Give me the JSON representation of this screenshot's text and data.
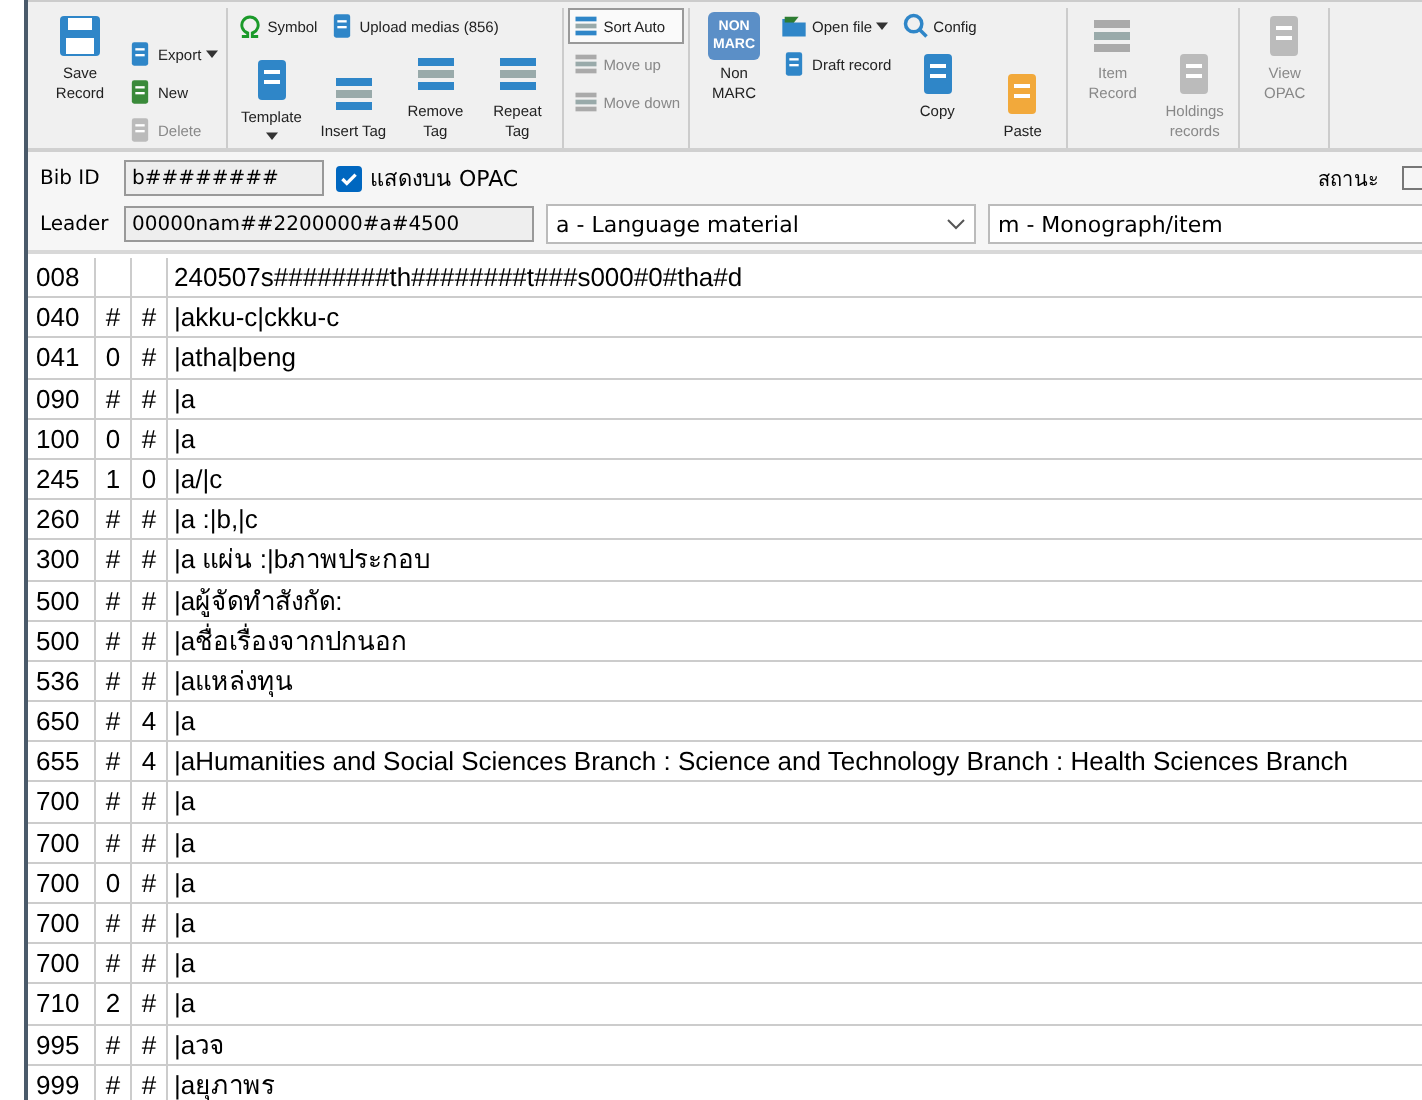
{
  "toolbar": {
    "groups": [
      {
        "columns": [
          [
            {
              "label": "Save Record",
              "kind": "large",
              "disabled": false
            }
          ],
          [
            {
              "label": "Export",
              "kind": "small",
              "disabled": false,
              "dropdown": true
            },
            {
              "label": "New",
              "kind": "small",
              "disabled": false
            },
            {
              "label": "Delete",
              "kind": "small",
              "disabled": true
            }
          ]
        ]
      },
      {
        "rows": [
          [
            {
              "label": "Symbol",
              "kind": "small",
              "disabled": false
            },
            {
              "label": "Upload medias (856)",
              "kind": "small",
              "disabled": false
            }
          ],
          [
            {
              "label": "Template",
              "kind": "large",
              "disabled": false,
              "dropdown": true
            },
            {
              "label": "Insert Tag",
              "kind": "large",
              "disabled": false
            },
            {
              "label": "Remove Tag",
              "kind": "large",
              "disabled": false
            },
            {
              "label": "Repeat Tag",
              "kind": "large",
              "disabled": false
            }
          ]
        ]
      },
      {
        "columns": [
          [
            {
              "label": "Sort Auto",
              "kind": "small",
              "disabled": false,
              "selected": true
            },
            {
              "label": "Move up",
              "kind": "small",
              "disabled": true
            },
            {
              "label": "Move down",
              "kind": "small",
              "disabled": true
            }
          ]
        ]
      },
      {
        "columns": [
          [
            {
              "label": "Non MARC",
              "kind": "large",
              "disabled": false,
              "badge": [
                "NON",
                "MARC"
              ]
            }
          ],
          [
            {
              "label": "Open file",
              "kind": "small",
              "disabled": false,
              "dropdown": true
            },
            {
              "label": "Draft record",
              "kind": "small",
              "disabled": false
            }
          ],
          [
            {
              "label": "Config",
              "kind": "small",
              "disabled": false
            },
            {
              "label": "Copy",
              "kind": "large",
              "disabled": false
            }
          ],
          [
            {
              "label": "Paste",
              "kind": "large",
              "disabled": false
            }
          ]
        ]
      },
      {
        "columns": [
          [
            {
              "label": "Item Record",
              "kind": "large",
              "disabled": true
            }
          ],
          [
            {
              "label": "Holdings records",
              "kind": "large",
              "disabled": true
            }
          ]
        ]
      },
      {
        "columns": [
          [
            {
              "label": "View OPAC",
              "kind": "large",
              "disabled": true
            }
          ]
        ]
      }
    ]
  },
  "form": {
    "bib_id": {
      "label": "Bib ID",
      "value": "b########"
    },
    "show_opac": {
      "label": "แสดงบน OPAC",
      "checked": true
    },
    "status": {
      "label": "สถานะ",
      "checked": false
    },
    "leader": {
      "label": "Leader",
      "value": "00000nam##2200000#a#4500"
    },
    "type_select": {
      "value": "a - Language material"
    },
    "level_select": {
      "value": "m - Monograph/item"
    }
  },
  "table": {
    "rows": [
      {
        "tag": "008",
        "data": "240507s########th########t###s000#0#tha#d"
      },
      {
        "tag": "040",
        "ind1": "#",
        "ind2": "#",
        "data": "|akku-c|ckku-c"
      },
      {
        "tag": "041",
        "ind1": "0",
        "ind2": "#",
        "data": "|atha|beng"
      },
      {
        "tag": "090",
        "ind1": "#",
        "ind2": "#",
        "data": "|a"
      },
      {
        "tag": "100",
        "ind1": "0",
        "ind2": "#",
        "data": "|a"
      },
      {
        "tag": "245",
        "ind1": "1",
        "ind2": "0",
        "data": "|a/|c"
      },
      {
        "tag": "260",
        "ind1": "#",
        "ind2": "#",
        "data": "|a :|b,|c"
      },
      {
        "tag": "300",
        "ind1": "#",
        "ind2": "#",
        "data": "|a แผ่น :|bภาพประกอบ"
      },
      {
        "tag": "500",
        "ind1": "#",
        "ind2": "#",
        "data": "|aผู้จัดทำสังกัด:"
      },
      {
        "tag": "500",
        "ind1": "#",
        "ind2": "#",
        "data": "|aชื่อเรื่องจากปกนอก"
      },
      {
        "tag": "536",
        "ind1": "#",
        "ind2": "#",
        "data": "|aแหล่งทุน"
      },
      {
        "tag": "650",
        "ind1": "#",
        "ind2": "4",
        "data": "|a"
      },
      {
        "tag": "655",
        "ind1": "#",
        "ind2": "4",
        "data": "|aHumanities and Social Sciences Branch : Science and Technology Branch : Health Sciences Branch"
      },
      {
        "tag": "700",
        "ind1": "#",
        "ind2": "#",
        "data": "|a"
      },
      {
        "tag": "700",
        "ind1": "#",
        "ind2": "#",
        "data": "|a"
      },
      {
        "tag": "700",
        "ind1": "0",
        "ind2": "#",
        "data": "|a"
      },
      {
        "tag": "700",
        "ind1": "#",
        "ind2": "#",
        "data": "|a"
      },
      {
        "tag": "700",
        "ind1": "#",
        "ind2": "#",
        "data": "|a"
      },
      {
        "tag": "710",
        "ind1": "2",
        "ind2": "#",
        "data": "|a"
      },
      {
        "tag": "995",
        "ind1": "#",
        "ind2": "#",
        "data": "|aวจ"
      },
      {
        "tag": "999",
        "ind1": "#",
        "ind2": "#",
        "data": "|aยุภาพร"
      }
    ]
  }
}
